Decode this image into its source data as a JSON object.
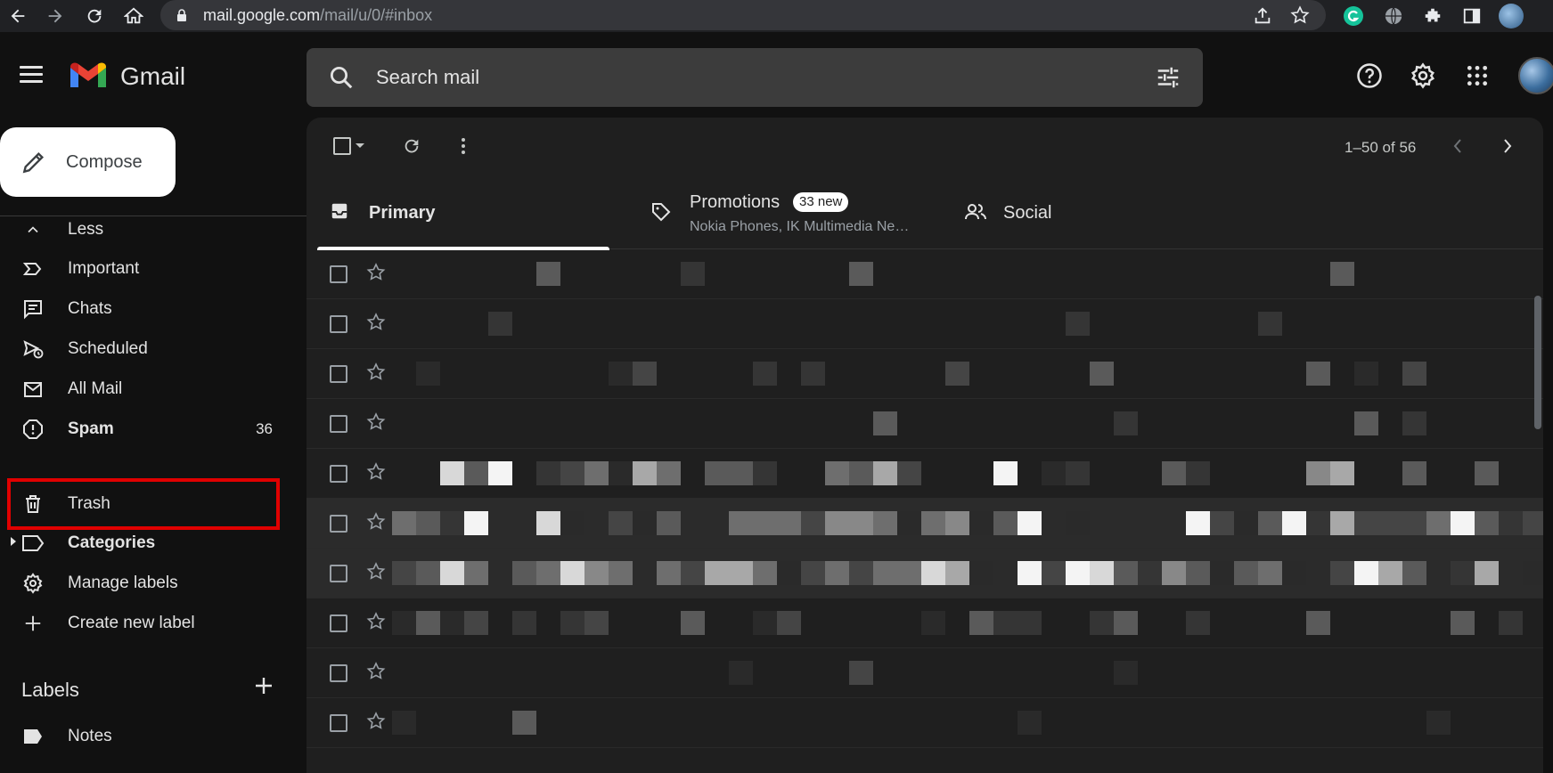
{
  "browser": {
    "url_host": "mail.google.com",
    "url_path": "/mail/u/0/#inbox"
  },
  "app": {
    "brand": "Gmail"
  },
  "search": {
    "placeholder": "Search mail"
  },
  "compose": {
    "label": "Compose"
  },
  "sidebar": {
    "items": [
      {
        "label": "Less",
        "icon": "chevron-up-icon",
        "count": ""
      },
      {
        "label": "Important",
        "icon": "important-icon",
        "count": ""
      },
      {
        "label": "Chats",
        "icon": "chat-icon",
        "count": ""
      },
      {
        "label": "Scheduled",
        "icon": "scheduled-icon",
        "count": ""
      },
      {
        "label": "All Mail",
        "icon": "all-mail-icon",
        "count": ""
      },
      {
        "label": "Spam",
        "icon": "spam-icon",
        "count": "36"
      },
      {
        "label": "Trash",
        "icon": "trash-icon",
        "count": ""
      },
      {
        "label": "Categories",
        "icon": "label-icon",
        "count": ""
      },
      {
        "label": "Manage labels",
        "icon": "gear-icon",
        "count": ""
      },
      {
        "label": "Create new label",
        "icon": "plus-icon",
        "count": ""
      }
    ],
    "labels_title": "Labels",
    "labels": [
      {
        "label": "Notes",
        "icon": "label-filled-icon"
      }
    ]
  },
  "toolbar": {
    "pager": "1–50 of 56"
  },
  "tabs": {
    "primary": {
      "label": "Primary"
    },
    "promotions": {
      "label": "Promotions",
      "badge": "33 new",
      "subtitle": "Nokia Phones, IK Multimedia Ne…"
    },
    "social": {
      "label": "Social"
    }
  },
  "colors": {
    "highlight": "#e00000",
    "panel": "#1f1f1f",
    "background": "#111111"
  }
}
